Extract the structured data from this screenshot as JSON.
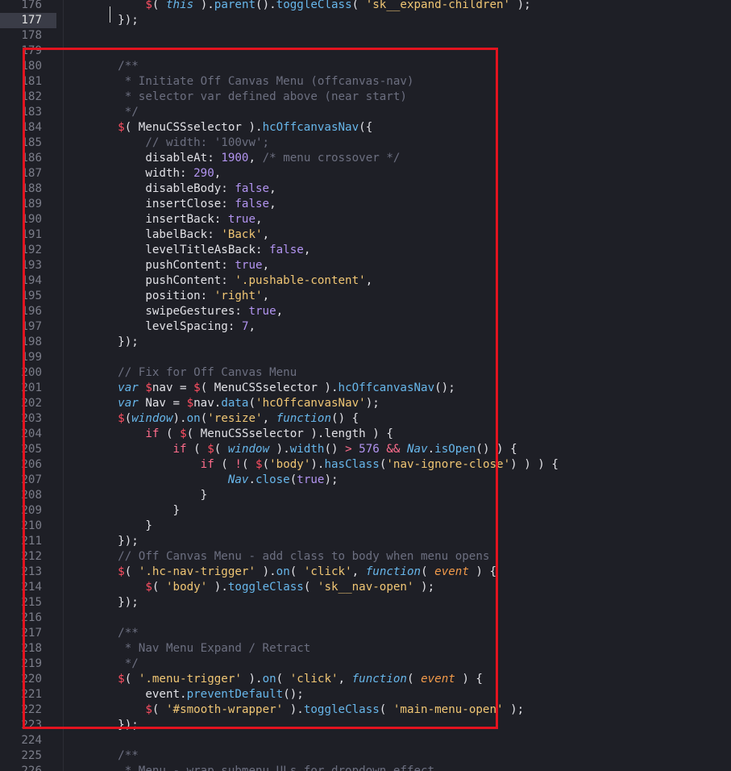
{
  "editor": {
    "active_line": 177,
    "lines": [
      {
        "n": 176,
        "tokens": [
          [
            "i",
            "        "
          ],
          [
            "dollar",
            "$"
          ],
          [
            "punc",
            "( "
          ],
          [
            "kw",
            "this"
          ],
          [
            "punc",
            " )."
          ],
          [
            "fn",
            "parent"
          ],
          [
            "punc",
            "()."
          ],
          [
            "fn",
            "toggleClass"
          ],
          [
            "punc",
            "( "
          ],
          [
            "str",
            "'sk__expand-children'"
          ],
          [
            "punc",
            " );"
          ]
        ]
      },
      {
        "n": 177,
        "tokens": [
          [
            "i",
            "    "
          ],
          [
            "punc",
            "});"
          ]
        ]
      },
      {
        "n": 178,
        "tokens": []
      },
      {
        "n": 179,
        "tokens": []
      },
      {
        "n": 180,
        "tokens": [
          [
            "i",
            "    "
          ],
          [
            "cmt",
            "/**"
          ]
        ]
      },
      {
        "n": 181,
        "tokens": [
          [
            "i",
            "    "
          ],
          [
            "cmt",
            " * Initiate Off Canvas Menu (offcanvas-nav)"
          ]
        ]
      },
      {
        "n": 182,
        "tokens": [
          [
            "i",
            "    "
          ],
          [
            "cmt",
            " * selector var defined above (near start)"
          ]
        ]
      },
      {
        "n": 183,
        "tokens": [
          [
            "i",
            "    "
          ],
          [
            "cmt",
            " */"
          ]
        ]
      },
      {
        "n": 184,
        "tokens": [
          [
            "i",
            "    "
          ],
          [
            "dollar",
            "$"
          ],
          [
            "punc",
            "( MenuCSSselector )."
          ],
          [
            "fn",
            "hcOffcanvasNav"
          ],
          [
            "punc",
            "({"
          ]
        ]
      },
      {
        "n": 185,
        "tokens": [
          [
            "i",
            "        "
          ],
          [
            "cmt",
            "// width: '100vw';"
          ]
        ]
      },
      {
        "n": 186,
        "tokens": [
          [
            "i",
            "        "
          ],
          [
            "plain",
            "disableAt: "
          ],
          [
            "num",
            "1900"
          ],
          [
            "punc",
            ", "
          ],
          [
            "cmt",
            "/* menu crossover */"
          ]
        ]
      },
      {
        "n": 187,
        "tokens": [
          [
            "i",
            "        "
          ],
          [
            "plain",
            "width: "
          ],
          [
            "num",
            "290"
          ],
          [
            "punc",
            ","
          ]
        ]
      },
      {
        "n": 188,
        "tokens": [
          [
            "i",
            "        "
          ],
          [
            "plain",
            "disableBody: "
          ],
          [
            "bool",
            "false"
          ],
          [
            "punc",
            ","
          ]
        ]
      },
      {
        "n": 189,
        "tokens": [
          [
            "i",
            "        "
          ],
          [
            "plain",
            "insertClose: "
          ],
          [
            "bool",
            "false"
          ],
          [
            "punc",
            ","
          ]
        ]
      },
      {
        "n": 190,
        "tokens": [
          [
            "i",
            "        "
          ],
          [
            "plain",
            "insertBack: "
          ],
          [
            "bool",
            "true"
          ],
          [
            "punc",
            ","
          ]
        ]
      },
      {
        "n": 191,
        "tokens": [
          [
            "i",
            "        "
          ],
          [
            "plain",
            "labelBack: "
          ],
          [
            "str",
            "'Back'"
          ],
          [
            "punc",
            ","
          ]
        ]
      },
      {
        "n": 192,
        "tokens": [
          [
            "i",
            "        "
          ],
          [
            "plain",
            "levelTitleAsBack: "
          ],
          [
            "bool",
            "false"
          ],
          [
            "punc",
            ","
          ]
        ]
      },
      {
        "n": 193,
        "tokens": [
          [
            "i",
            "        "
          ],
          [
            "plain",
            "pushContent: "
          ],
          [
            "bool",
            "true"
          ],
          [
            "punc",
            ","
          ]
        ]
      },
      {
        "n": 194,
        "tokens": [
          [
            "i",
            "        "
          ],
          [
            "plain",
            "pushContent: "
          ],
          [
            "str",
            "'.pushable-content'"
          ],
          [
            "punc",
            ","
          ]
        ]
      },
      {
        "n": 195,
        "tokens": [
          [
            "i",
            "        "
          ],
          [
            "plain",
            "position: "
          ],
          [
            "str",
            "'right'"
          ],
          [
            "punc",
            ","
          ]
        ]
      },
      {
        "n": 196,
        "tokens": [
          [
            "i",
            "        "
          ],
          [
            "plain",
            "swipeGestures: "
          ],
          [
            "bool",
            "true"
          ],
          [
            "punc",
            ","
          ]
        ]
      },
      {
        "n": 197,
        "tokens": [
          [
            "i",
            "        "
          ],
          [
            "plain",
            "levelSpacing: "
          ],
          [
            "num",
            "7"
          ],
          [
            "punc",
            ","
          ]
        ]
      },
      {
        "n": 198,
        "tokens": [
          [
            "i",
            "    "
          ],
          [
            "punc",
            "});"
          ]
        ]
      },
      {
        "n": 199,
        "tokens": []
      },
      {
        "n": 200,
        "tokens": [
          [
            "i",
            "    "
          ],
          [
            "cmt",
            "// Fix for Off Canvas Menu"
          ]
        ]
      },
      {
        "n": 201,
        "tokens": [
          [
            "i",
            "    "
          ],
          [
            "kw",
            "var"
          ],
          [
            "plain",
            " "
          ],
          [
            "dollar",
            "$"
          ],
          [
            "plain",
            "nav = "
          ],
          [
            "dollar",
            "$"
          ],
          [
            "punc",
            "( MenuCSSselector )."
          ],
          [
            "fn",
            "hcOffcanvasNav"
          ],
          [
            "punc",
            "();"
          ]
        ]
      },
      {
        "n": 202,
        "tokens": [
          [
            "i",
            "    "
          ],
          [
            "kw",
            "var"
          ],
          [
            "plain",
            " Nav = "
          ],
          [
            "dollar",
            "$"
          ],
          [
            "plain",
            "nav."
          ],
          [
            "fn",
            "data"
          ],
          [
            "punc",
            "("
          ],
          [
            "str",
            "'hcOffcanvasNav'"
          ],
          [
            "punc",
            ");"
          ]
        ]
      },
      {
        "n": 203,
        "tokens": [
          [
            "i",
            "    "
          ],
          [
            "dollar",
            "$"
          ],
          [
            "punc",
            "("
          ],
          [
            "global",
            "window"
          ],
          [
            "punc",
            ")."
          ],
          [
            "fn",
            "on"
          ],
          [
            "punc",
            "("
          ],
          [
            "str",
            "'resize'"
          ],
          [
            "punc",
            ", "
          ],
          [
            "kw",
            "function"
          ],
          [
            "punc",
            "() {"
          ]
        ]
      },
      {
        "n": 204,
        "tokens": [
          [
            "i",
            "        "
          ],
          [
            "op",
            "if"
          ],
          [
            "punc",
            " ( "
          ],
          [
            "dollar",
            "$"
          ],
          [
            "punc",
            "( MenuCSSselector ).length ) {"
          ]
        ]
      },
      {
        "n": 205,
        "tokens": [
          [
            "i",
            "            "
          ],
          [
            "op",
            "if"
          ],
          [
            "punc",
            " ( "
          ],
          [
            "dollar",
            "$"
          ],
          [
            "punc",
            "( "
          ],
          [
            "global",
            "window"
          ],
          [
            "punc",
            " )."
          ],
          [
            "fn",
            "width"
          ],
          [
            "punc",
            "() "
          ],
          [
            "op",
            ">"
          ],
          [
            "plain",
            " "
          ],
          [
            "num",
            "576"
          ],
          [
            "plain",
            " "
          ],
          [
            "op",
            "&&"
          ],
          [
            "plain",
            " "
          ],
          [
            "global",
            "Nav"
          ],
          [
            "punc",
            "."
          ],
          [
            "fn",
            "isOpen"
          ],
          [
            "punc",
            "() ) {"
          ]
        ]
      },
      {
        "n": 206,
        "tokens": [
          [
            "i",
            "                "
          ],
          [
            "op",
            "if"
          ],
          [
            "punc",
            " ( "
          ],
          [
            "op",
            "!"
          ],
          [
            "punc",
            "( "
          ],
          [
            "dollar",
            "$"
          ],
          [
            "punc",
            "("
          ],
          [
            "str",
            "'body'"
          ],
          [
            "punc",
            ")."
          ],
          [
            "fn",
            "hasClass"
          ],
          [
            "punc",
            "("
          ],
          [
            "str",
            "'nav-ignore-close'"
          ],
          [
            "punc",
            ") ) ) {"
          ]
        ]
      },
      {
        "n": 207,
        "tokens": [
          [
            "i",
            "                    "
          ],
          [
            "global",
            "Nav"
          ],
          [
            "punc",
            "."
          ],
          [
            "fn",
            "close"
          ],
          [
            "punc",
            "("
          ],
          [
            "bool",
            "true"
          ],
          [
            "punc",
            ");"
          ]
        ]
      },
      {
        "n": 208,
        "tokens": [
          [
            "i",
            "                "
          ],
          [
            "punc",
            "}"
          ]
        ]
      },
      {
        "n": 209,
        "tokens": [
          [
            "i",
            "            "
          ],
          [
            "punc",
            "}"
          ]
        ]
      },
      {
        "n": 210,
        "tokens": [
          [
            "i",
            "        "
          ],
          [
            "punc",
            "}"
          ]
        ]
      },
      {
        "n": 211,
        "tokens": [
          [
            "i",
            "    "
          ],
          [
            "punc",
            "});"
          ]
        ]
      },
      {
        "n": 212,
        "tokens": [
          [
            "i",
            "    "
          ],
          [
            "cmt",
            "// Off Canvas Menu - add class to body when menu opens"
          ]
        ]
      },
      {
        "n": 213,
        "tokens": [
          [
            "i",
            "    "
          ],
          [
            "dollar",
            "$"
          ],
          [
            "punc",
            "( "
          ],
          [
            "str",
            "'.hc-nav-trigger'"
          ],
          [
            "punc",
            " )."
          ],
          [
            "fn",
            "on"
          ],
          [
            "punc",
            "( "
          ],
          [
            "str",
            "'click'"
          ],
          [
            "punc",
            ", "
          ],
          [
            "kw",
            "function"
          ],
          [
            "punc",
            "( "
          ],
          [
            "param",
            "event"
          ],
          [
            "punc",
            " ) {"
          ]
        ]
      },
      {
        "n": 214,
        "tokens": [
          [
            "i",
            "        "
          ],
          [
            "dollar",
            "$"
          ],
          [
            "punc",
            "( "
          ],
          [
            "str",
            "'body'"
          ],
          [
            "punc",
            " )."
          ],
          [
            "fn",
            "toggleClass"
          ],
          [
            "punc",
            "( "
          ],
          [
            "str",
            "'sk__nav-open'"
          ],
          [
            "punc",
            " );"
          ]
        ]
      },
      {
        "n": 215,
        "tokens": [
          [
            "i",
            "    "
          ],
          [
            "punc",
            "});"
          ]
        ]
      },
      {
        "n": 216,
        "tokens": []
      },
      {
        "n": 217,
        "tokens": [
          [
            "i",
            "    "
          ],
          [
            "cmt",
            "/**"
          ]
        ]
      },
      {
        "n": 218,
        "tokens": [
          [
            "i",
            "    "
          ],
          [
            "cmt",
            " * Nav Menu Expand / Retract"
          ]
        ]
      },
      {
        "n": 219,
        "tokens": [
          [
            "i",
            "    "
          ],
          [
            "cmt",
            " */"
          ]
        ]
      },
      {
        "n": 220,
        "tokens": [
          [
            "i",
            "    "
          ],
          [
            "dollar",
            "$"
          ],
          [
            "punc",
            "( "
          ],
          [
            "str",
            "'.menu-trigger'"
          ],
          [
            "punc",
            " )."
          ],
          [
            "fn",
            "on"
          ],
          [
            "punc",
            "( "
          ],
          [
            "str",
            "'click'"
          ],
          [
            "punc",
            ", "
          ],
          [
            "kw",
            "function"
          ],
          [
            "punc",
            "( "
          ],
          [
            "param",
            "event"
          ],
          [
            "punc",
            " ) {"
          ]
        ]
      },
      {
        "n": 221,
        "tokens": [
          [
            "i",
            "        "
          ],
          [
            "plain",
            "event."
          ],
          [
            "fn",
            "preventDefault"
          ],
          [
            "punc",
            "();"
          ]
        ]
      },
      {
        "n": 222,
        "tokens": [
          [
            "i",
            "        "
          ],
          [
            "dollar",
            "$"
          ],
          [
            "punc",
            "( "
          ],
          [
            "str",
            "'#smooth-wrapper'"
          ],
          [
            "punc",
            " )."
          ],
          [
            "fn",
            "toggleClass"
          ],
          [
            "punc",
            "( "
          ],
          [
            "str",
            "'main-menu-open'"
          ],
          [
            "punc",
            " );"
          ]
        ]
      },
      {
        "n": 223,
        "tokens": [
          [
            "i",
            "    "
          ],
          [
            "punc",
            "});"
          ]
        ]
      },
      {
        "n": 224,
        "tokens": []
      },
      {
        "n": 225,
        "tokens": [
          [
            "i",
            "    "
          ],
          [
            "cmt",
            "/**"
          ]
        ]
      },
      {
        "n": 226,
        "tokens": [
          [
            "i",
            "    "
          ],
          [
            "cmt",
            " * Menu - wrap submenu ULs for dropdown effect"
          ]
        ]
      }
    ]
  },
  "colors": {
    "background": "#1e1f26",
    "highlight_box": "#e3131f",
    "comment": "#6c6f80",
    "string": "#f0c674",
    "number": "#b294f0",
    "keyword": "#67b6ea",
    "dollar": "#ff4f62"
  }
}
